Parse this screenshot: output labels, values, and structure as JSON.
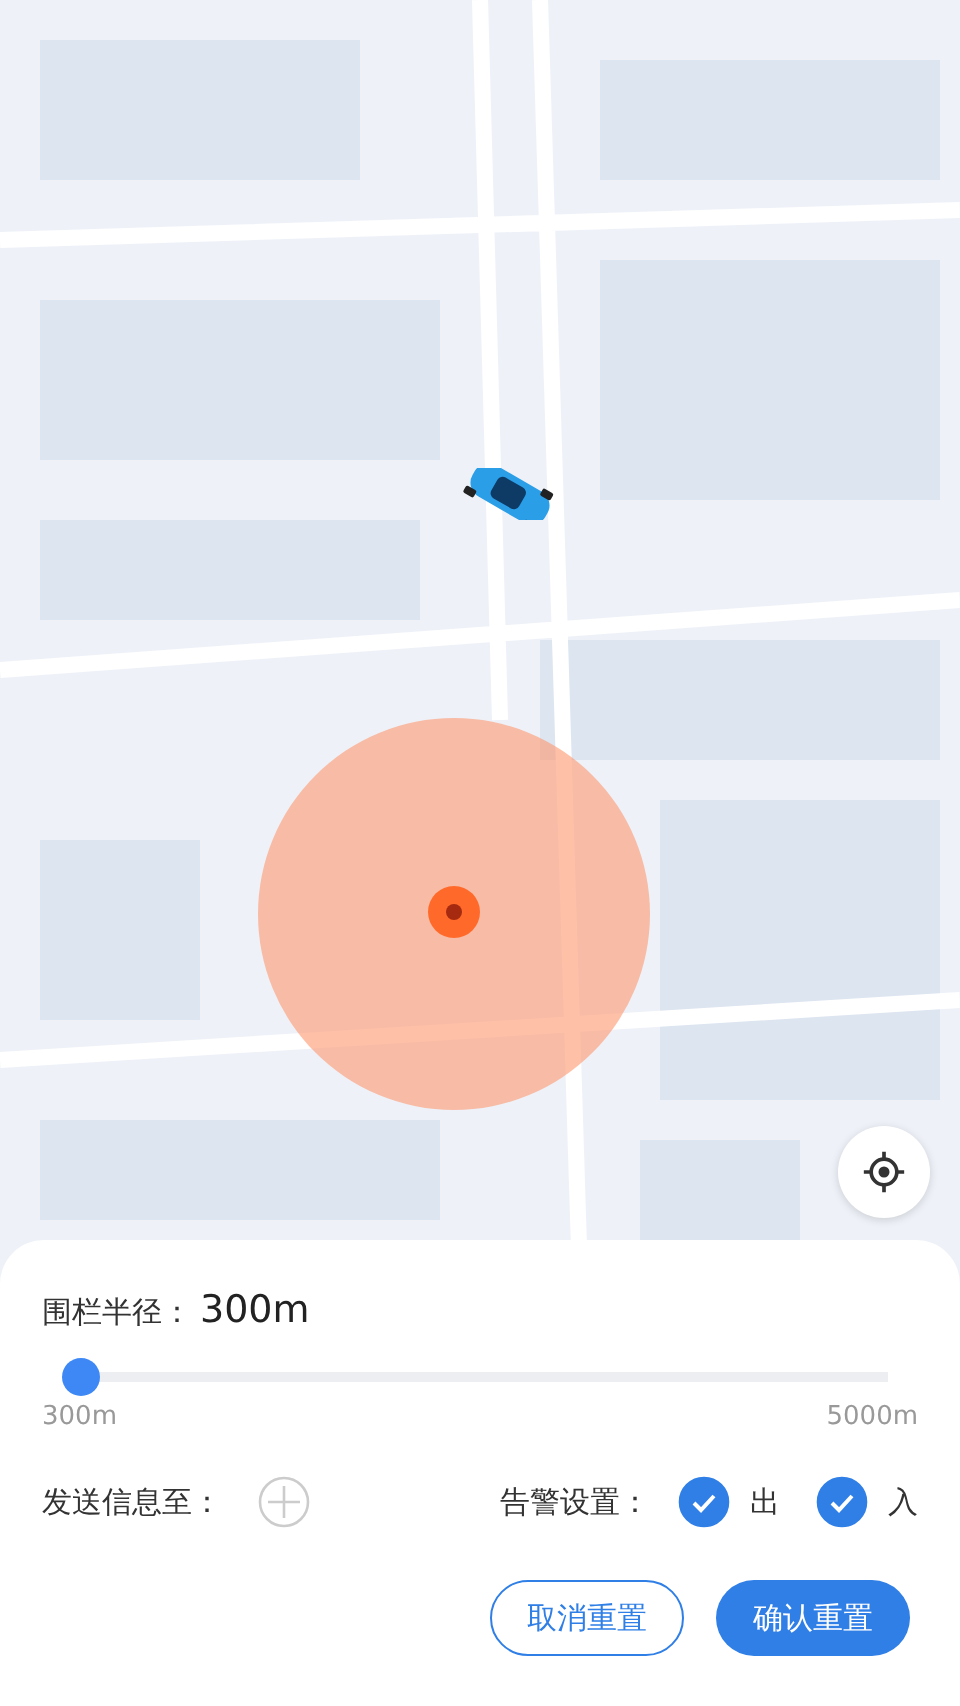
{
  "radius": {
    "label": "围栏半径：",
    "value": "300m",
    "level": 0,
    "min_label": "300m",
    "max_label": "5000m"
  },
  "send_to": {
    "label": "发送信息至："
  },
  "alarm": {
    "label": "告警设置：",
    "options": [
      {
        "label": "出",
        "checked": true
      },
      {
        "label": "入",
        "checked": true
      }
    ]
  },
  "buttons": [
    {
      "label": "取消重置",
      "kind": "outline"
    },
    {
      "label": "确认重置",
      "kind": "primary"
    }
  ]
}
